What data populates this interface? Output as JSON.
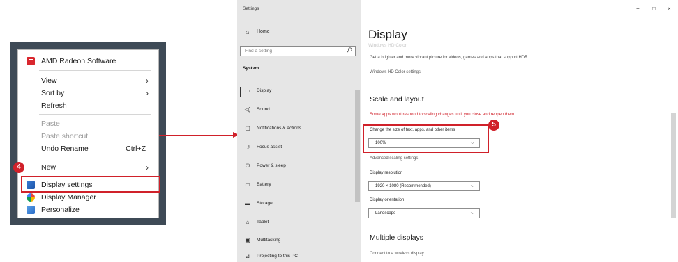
{
  "context_menu": {
    "items": [
      {
        "label": "AMD Radeon Software",
        "icon": "amd-radeon-icon",
        "chevron": "",
        "shortcut": "",
        "disabled": false
      },
      {
        "label": "View",
        "chevron": "›",
        "shortcut": "",
        "disabled": false
      },
      {
        "label": "Sort by",
        "chevron": "›",
        "shortcut": "",
        "disabled": false
      },
      {
        "label": "Refresh",
        "chevron": "",
        "shortcut": "",
        "disabled": false
      },
      {
        "label": "Paste",
        "chevron": "",
        "shortcut": "",
        "disabled": true
      },
      {
        "label": "Paste shortcut",
        "chevron": "",
        "shortcut": "",
        "disabled": true
      },
      {
        "label": "Undo Rename",
        "chevron": "",
        "shortcut": "Ctrl+Z",
        "disabled": false
      },
      {
        "label": "New",
        "chevron": "›",
        "shortcut": "",
        "disabled": false
      },
      {
        "label": "Display settings",
        "icon": "display-icon",
        "chevron": "",
        "shortcut": "",
        "disabled": false
      },
      {
        "label": "Display Manager",
        "icon": "display-manager-icon",
        "chevron": "",
        "shortcut": "",
        "disabled": false
      },
      {
        "label": "Personalize",
        "icon": "personalize-icon",
        "chevron": "",
        "shortcut": "",
        "disabled": false
      }
    ]
  },
  "annotations": {
    "step4": "4",
    "step5": "5"
  },
  "settings": {
    "window_title": "Settings",
    "home_label": "Home",
    "search_placeholder": "Find a setting",
    "section_label": "System",
    "nav": [
      {
        "label": "Display",
        "icon": "display-icon",
        "glyph": "▭",
        "active": true
      },
      {
        "label": "Sound",
        "icon": "sound-icon",
        "glyph": "◁)",
        "active": false
      },
      {
        "label": "Notifications & actions",
        "icon": "notifications-icon",
        "glyph": "▢",
        "active": false
      },
      {
        "label": "Focus assist",
        "icon": "focus-assist-icon",
        "glyph": "☽",
        "active": false
      },
      {
        "label": "Power & sleep",
        "icon": "power-icon",
        "glyph": "⏻",
        "active": false
      },
      {
        "label": "Battery",
        "icon": "battery-icon",
        "glyph": "▭",
        "active": false
      },
      {
        "label": "Storage",
        "icon": "storage-icon",
        "glyph": "▬",
        "active": false
      },
      {
        "label": "Tablet",
        "icon": "tablet-icon",
        "glyph": "⌂",
        "active": false
      },
      {
        "label": "Multitasking",
        "icon": "multitasking-icon",
        "glyph": "▣",
        "active": false
      },
      {
        "label": "Projecting to this PC",
        "icon": "projecting-icon",
        "glyph": "⊿",
        "active": false
      }
    ],
    "window_controls": {
      "minimize": "−",
      "maximize": "□",
      "close": "×"
    },
    "page_title": "Display",
    "faded_header": "Windows HD Color",
    "hdr_description": "Get a brighter and more vibrant picture for videos, games and apps that support HDR.",
    "hdr_link": "Windows HD Color settings",
    "scale_header": "Scale and layout",
    "scale_warning": "Some apps won't respond to scaling changes until you close and reopen them.",
    "text_size_label": "Change the size of text, apps, and other items",
    "text_size_value": "100%",
    "advanced_scaling_link": "Advanced scaling settings",
    "resolution_label": "Display resolution",
    "resolution_value": "1920 × 1080 (Recommended)",
    "orientation_label": "Display orientation",
    "orientation_value": "Landscape",
    "multiple_displays_header": "Multiple displays",
    "wireless_link": "Connect to a wireless display"
  }
}
